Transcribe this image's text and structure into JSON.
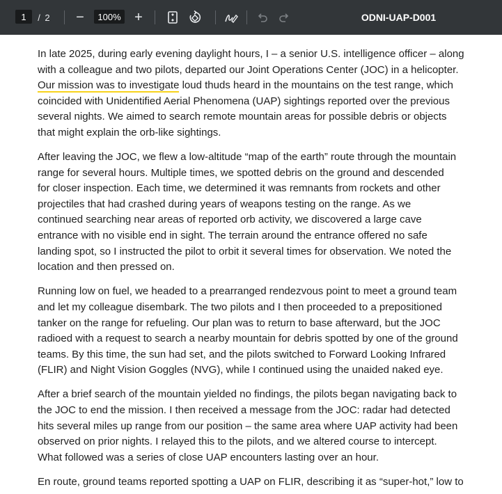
{
  "toolbar": {
    "page_current": "1",
    "page_separator": "/",
    "page_total": "2",
    "zoom_out_symbol": "−",
    "zoom_level": "100%",
    "zoom_in_symbol": "+",
    "document_title": "ODNI-UAP-D001",
    "icons": [
      "fit-page-icon",
      "rotate-icon",
      "annotate-pen-icon",
      "undo-icon",
      "redo-icon"
    ],
    "background_color": "#323639"
  },
  "document": {
    "highlight_color": "#f7d31b",
    "paragraphs": [
      {
        "lines": [
          "In late 2025, during early evening daylight hours, I – a senior U.S. intelligence officer – along",
          "with a colleague and two pilots, departed our Joint Operations Center (JOC) in a helicopter.",
          "loud thuds heard in the mountains on the test range, which",
          "coincided with Unidentified Aerial Phenomena (UAP) sightings reported over the previous",
          "several nights.  We aimed to search remote mountain areas for possible debris or objects",
          "that might explain the orb-like sightings."
        ],
        "highlighted": "Our mission was to investigate"
      },
      {
        "lines": [
          "After leaving the JOC, we flew a low-altitude “map of the earth” route through the mountain",
          "range for several hours.  Multiple times, we spotted debris on the ground and descended",
          "for closer inspection.  Each time, we determined it was remnants from rockets and other",
          "projectiles that had crashed during years of weapons testing on the range.  As we",
          "continued searching near areas of reported orb activity, we discovered a large cave",
          "entrance with no visible end in sight.  The terrain around the entrance offered no safe",
          "landing spot, so I instructed the pilot to orbit it several times for observation.  We noted the",
          "location and then pressed on."
        ]
      },
      {
        "lines": [
          "Running low on fuel, we headed to a prearranged rendezvous point to meet a ground team",
          "and let my colleague disembark.  The two pilots and I then proceeded to a prepositioned",
          "tanker on the range for refueling.  Our plan was to return to base afterward, but the JOC",
          "radioed with a request to search a nearby mountain for debris spotted by one of the ground",
          "teams.  By this time, the sun had set, and the pilots switched to Forward Looking Infrared",
          "(FLIR) and Night Vision Goggles (NVG), while I continued using the unaided naked eye."
        ]
      },
      {
        "lines": [
          "After a brief search of the mountain yielded no findings, the pilots began navigating back to",
          "the JOC to end the mission.  I then received a message from the JOC:  radar had detected",
          "hits several miles up range from our position – the same area where UAP activity had been",
          "observed on prior nights.  I relayed this to the pilots, and we altered course to intercept.",
          "What followed was a series of close UAP encounters lasting over an hour."
        ]
      },
      {
        "lines": [
          "En route, ground teams reported spotting a UAP on FLIR, describing it as “super-hot,” low to"
        ]
      }
    ]
  }
}
